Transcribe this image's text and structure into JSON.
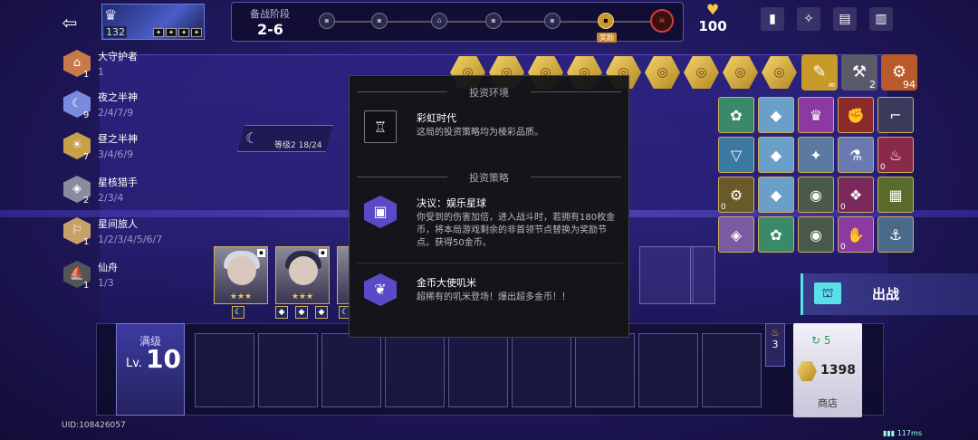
{
  "top": {
    "player_level": "132",
    "stage_label": "备战阶段",
    "stage_value": "2-6",
    "reward_tag": "奖励",
    "hp": "100",
    "exit_icon": "exit-icon",
    "icons": [
      "book-icon",
      "hint-icon",
      "codex-icon",
      "stats-icon"
    ]
  },
  "factions": [
    {
      "count": "1",
      "name": "大守护者",
      "tiers": "1",
      "icon": "guardian-icon",
      "color": "#c87a4a"
    },
    {
      "count": "9",
      "name": "夜之半神",
      "tiers": "2/4/7/9",
      "icon": "moon-icon",
      "color": "#7a8ae0"
    },
    {
      "count": "7",
      "name": "昼之半神",
      "tiers": "3/4/6/9",
      "icon": "sun-icon",
      "color": "#c8a04a"
    },
    {
      "count": "2",
      "name": "星核猎手",
      "tiers": "2/3/4",
      "icon": "stellaron-icon",
      "color": "#8a8aa0"
    },
    {
      "count": "1",
      "name": "星间旅人",
      "tiers": "1/2/3/4/5/6/7",
      "icon": "traveler-icon",
      "color": "#c8a06a"
    },
    {
      "count": "1",
      "name": "仙舟",
      "tiers": "1/3",
      "icon": "xianzhou-icon",
      "color": "#666"
    }
  ],
  "level_badge": {
    "text": "等级2 18/24"
  },
  "bottom": {
    "level_label": "满级",
    "level_prefix": "Lv.",
    "level_value": "10",
    "fire_count": "3",
    "refresh_cost": "5",
    "money": "1398",
    "shop_label": "商店",
    "battle_label": "出战",
    "uid": "UID:108426057",
    "ping": "117ms"
  },
  "popup": {
    "env_title": "投资环境",
    "env_name": "彩虹时代",
    "env_desc": "这局的投资策略均为棱彩品质。",
    "strategy_title": "投资策略",
    "s1_name": "决议：娱乐星球",
    "s1_desc": "你受到的伤害加倍，进入战斗时，若拥有180枚金币，将本局游戏剩余的非首领节点替换为奖励节点。获得50金币。",
    "s2_name": "金币大使叽米",
    "s2_desc": "超稀有的叽米登场！爆出超多金币！！"
  },
  "tools": [
    {
      "icon": "gold-tool-icon",
      "badge": "∞"
    },
    {
      "icon": "wrench-icon",
      "badge": "2"
    },
    {
      "icon": "orange-tool-icon",
      "badge": "94"
    }
  ],
  "items": [
    {
      "icon": "gear-item-icon",
      "badge": ""
    },
    {
      "icon": "crystal-item-icon",
      "badge": ""
    },
    {
      "icon": "hat-item-icon",
      "badge": ""
    },
    {
      "icon": "boxing-glove-item-icon",
      "badge": ""
    },
    {
      "icon": "gun-item-icon",
      "badge": ""
    },
    {
      "icon": "drink-item-icon",
      "badge": ""
    },
    {
      "icon": "crystal-item-icon",
      "badge": ""
    },
    {
      "icon": "sword-item-icon",
      "badge": ""
    },
    {
      "icon": "flask-item-icon",
      "badge": ""
    },
    {
      "icon": "boot-item-icon",
      "badge": "0"
    },
    {
      "icon": "robot-item-icon",
      "badge": "0"
    },
    {
      "icon": "crystal-item-icon",
      "badge": ""
    },
    {
      "icon": "disc-item-icon",
      "badge": ""
    },
    {
      "icon": "cloak-item-icon",
      "badge": "0"
    },
    {
      "icon": "cube-item-icon",
      "badge": ""
    },
    {
      "icon": "shield-item-icon",
      "badge": ""
    },
    {
      "icon": "gear-item-icon",
      "badge": ""
    },
    {
      "icon": "disc-item-icon",
      "badge": ""
    },
    {
      "icon": "glove-item-icon",
      "badge": "0"
    },
    {
      "icon": "hook-item-icon",
      "badge": ""
    }
  ]
}
